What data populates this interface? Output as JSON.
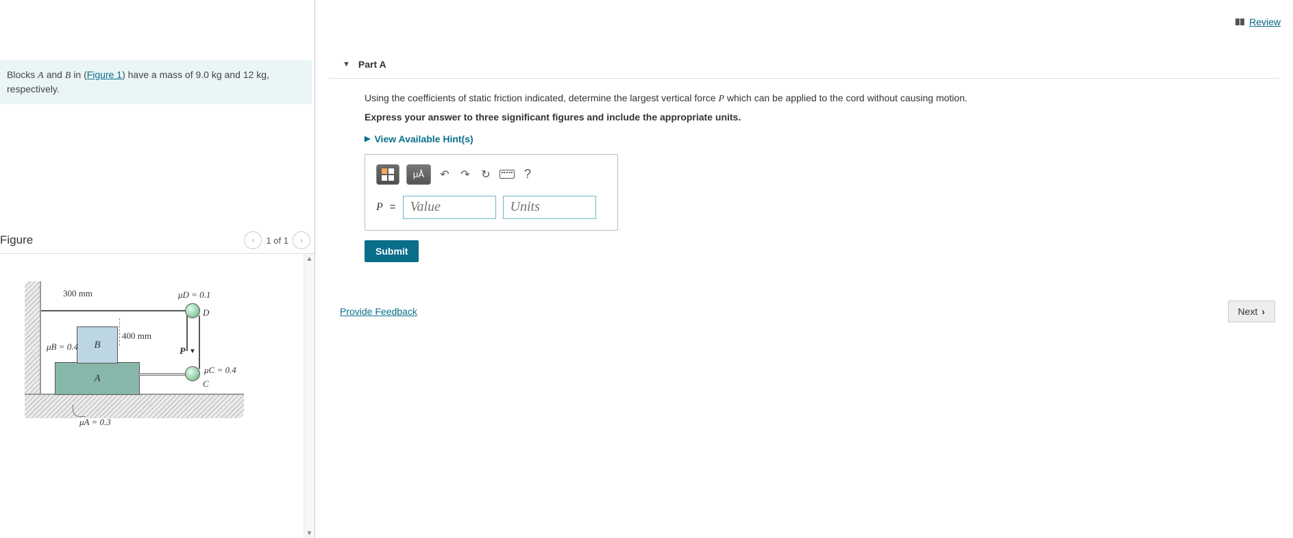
{
  "review_label": "Review",
  "problem": {
    "intro_pre": "Blocks ",
    "intro_a": "A",
    "intro_mid1": " and ",
    "intro_b": "B",
    "intro_mid2": " in (",
    "figure_link": "Figure 1",
    "intro_post": ") have a mass of 9.0 kg and 12 kg, respectively."
  },
  "figure": {
    "title": "Figure",
    "counter": "1 of 1",
    "dim_300": "300 mm",
    "dim_400": "400 mm",
    "mu_d": "μD = 0.1",
    "mu_c": "μC = 0.4",
    "mu_b": "μB = 0.4",
    "mu_a": "μA = 0.3",
    "label_a": "A",
    "label_b": "B",
    "label_c": "C",
    "label_d": "D",
    "label_p": "P"
  },
  "part": {
    "title": "Part A",
    "prompt_pre": "Using the coefficients of static friction indicated, determine the largest vertical force ",
    "prompt_var": "P",
    "prompt_post": " which can be applied to the cord without causing motion.",
    "instruction": "Express your answer to three significant figures and include the appropriate units.",
    "hints": "View Available Hint(s)",
    "var_label": "P",
    "eq": "=",
    "value_placeholder": "Value",
    "units_placeholder": "Units",
    "toolbar_unit": "μÅ",
    "help": "?",
    "submit": "Submit"
  },
  "footer": {
    "feedback": "Provide Feedback",
    "next": "Next"
  }
}
